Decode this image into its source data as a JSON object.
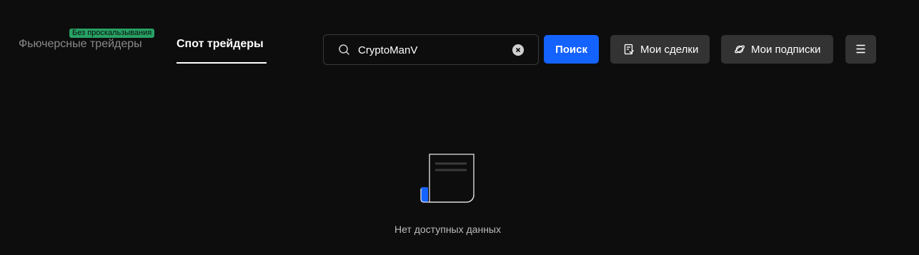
{
  "tabs": {
    "futures_label": "Фьючерсные трейдеры",
    "futures_badge": "Без проскальзывания",
    "spot_label": "Спот трейдеры"
  },
  "search": {
    "value": "CryptoManV",
    "placeholder": ""
  },
  "buttons": {
    "search_label": "Поиск",
    "my_trades_label": "Мои сделки",
    "my_subscriptions_label": "Мои подписки"
  },
  "empty_state": {
    "text": "Нет доступных данных"
  },
  "colors": {
    "background": "#0d0d0d",
    "accent_blue": "#1463ff",
    "badge_green": "#27a164",
    "button_gray": "#333333"
  },
  "icons": [
    "search-icon",
    "clear-icon",
    "trades-icon",
    "subscriptions-icon",
    "menu-icon",
    "empty-document-icon"
  ]
}
